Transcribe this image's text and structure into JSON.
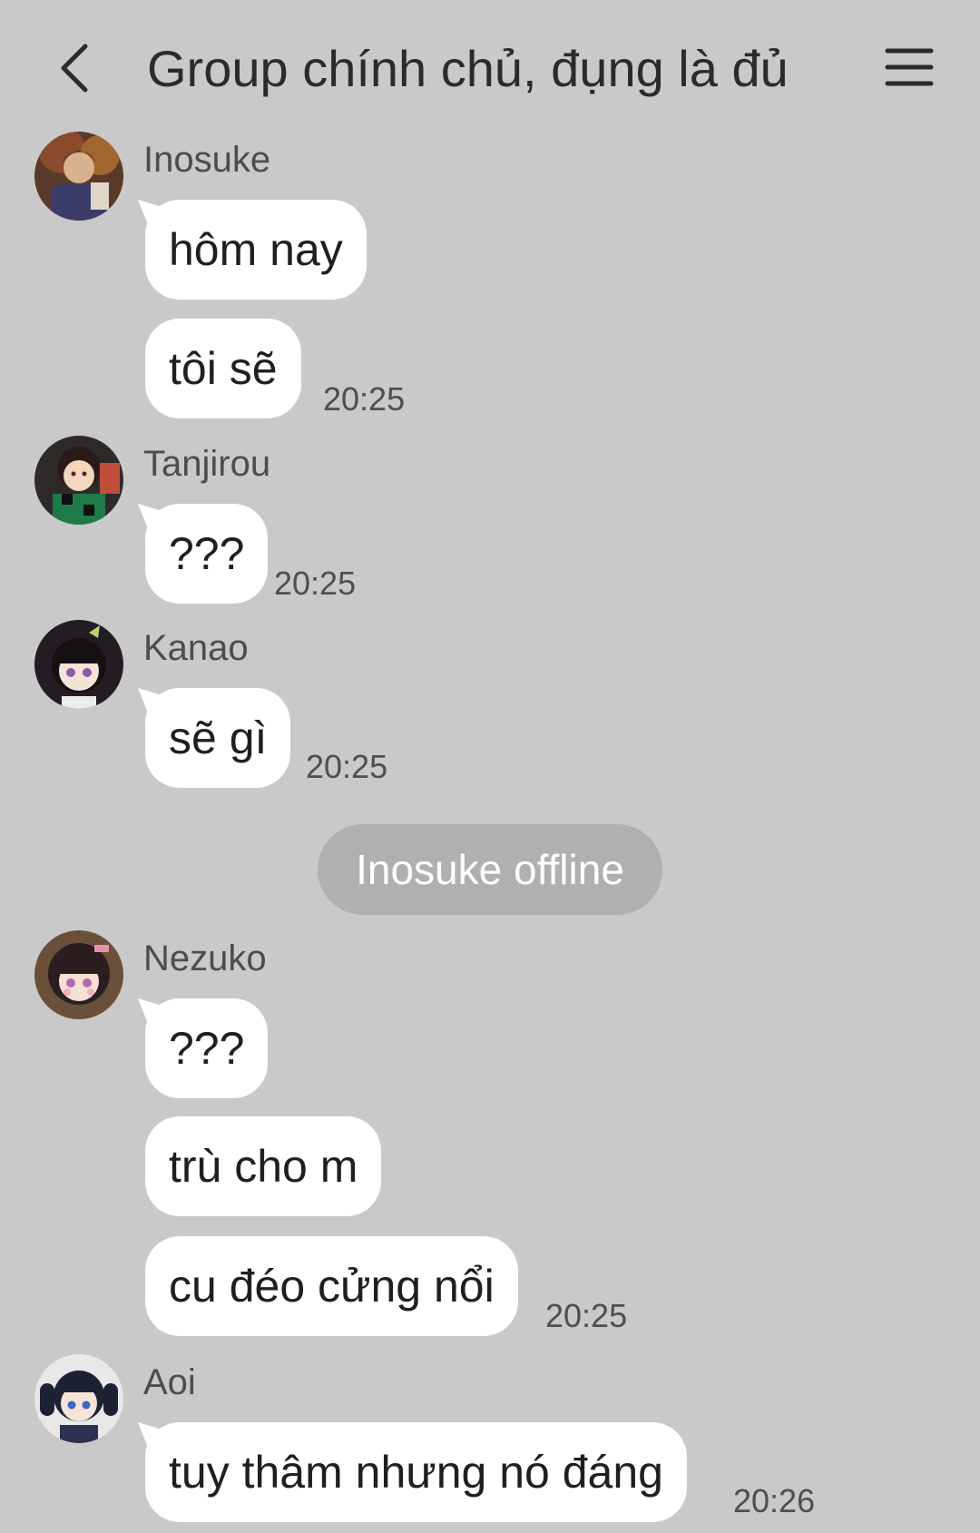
{
  "header": {
    "title": "Group chính chủ, đụng là đủ",
    "back_icon": "chevron-left-icon",
    "menu_icon": "hamburger-menu-icon"
  },
  "messages": [
    {
      "sender": "Inosuke",
      "lines": [
        "hôm nay",
        "tôi sẽ"
      ],
      "time": "20:25"
    },
    {
      "sender": "Tanjirou",
      "lines": [
        "???"
      ],
      "time": "20:25"
    },
    {
      "sender": "Kanao",
      "lines": [
        "sẽ gì"
      ],
      "time": "20:25"
    },
    {
      "sender": "Nezuko",
      "lines": [
        "???",
        "trù cho m",
        "cu đéo cửng nổi"
      ],
      "time": "20:25"
    },
    {
      "sender": "Aoi",
      "lines": [
        "tuy thâm nhưng nó đáng"
      ],
      "time": "20:26"
    }
  ],
  "system_notice": "Inosuke offline",
  "colors": {
    "background": "#c9c9c9",
    "bubble": "#ffffff",
    "notice": "#b0b0b0"
  }
}
